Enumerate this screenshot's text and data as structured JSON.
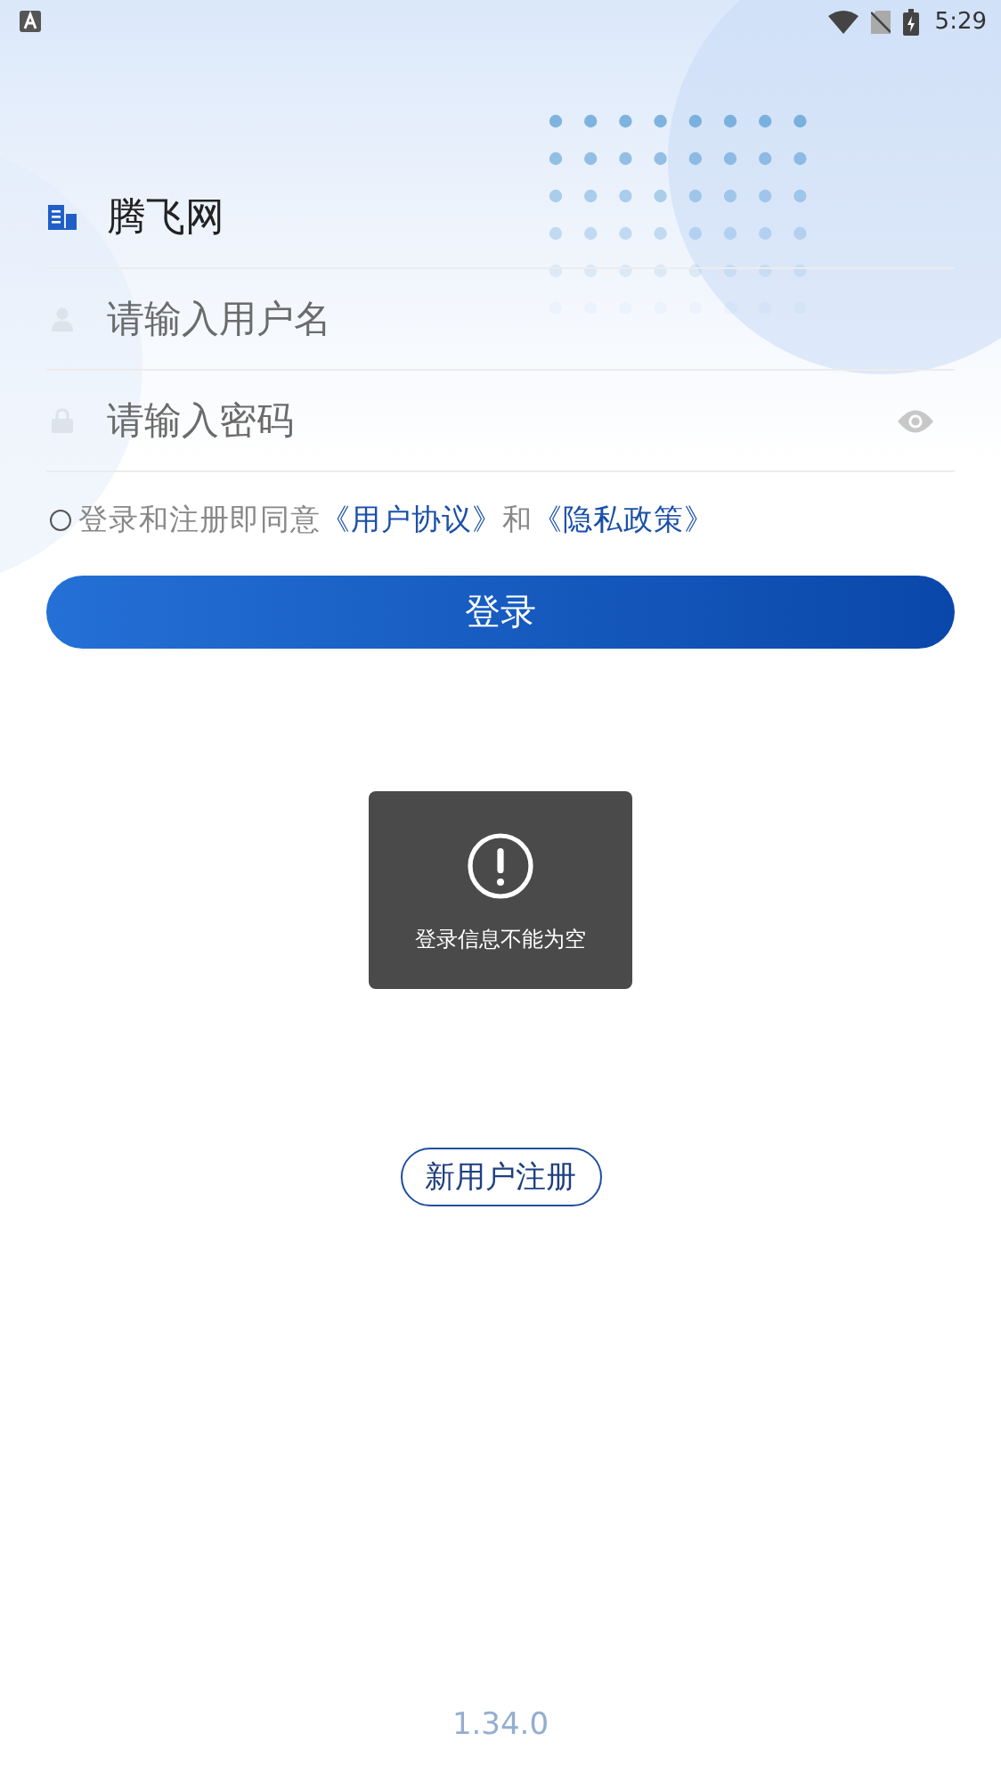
{
  "status_bar": {
    "time": "5:29"
  },
  "site": {
    "name": "腾飞网"
  },
  "fields": [
    {
      "kind": "username",
      "placeholder": "请输入用户名"
    },
    {
      "kind": "password",
      "placeholder": "请输入密码"
    }
  ],
  "agreement": {
    "checked": false,
    "parts": [
      {
        "kind": "text",
        "text": "登录和注册即同意"
      },
      {
        "kind": "link",
        "text": "《用户协议》"
      },
      {
        "kind": "text",
        "text": "和"
      },
      {
        "kind": "link",
        "text": "《隐私政策》"
      }
    ]
  },
  "login_button": "登录",
  "toast": {
    "message": "登录信息不能为空"
  },
  "register_button": "新用户注册",
  "version": "1.34.0"
}
